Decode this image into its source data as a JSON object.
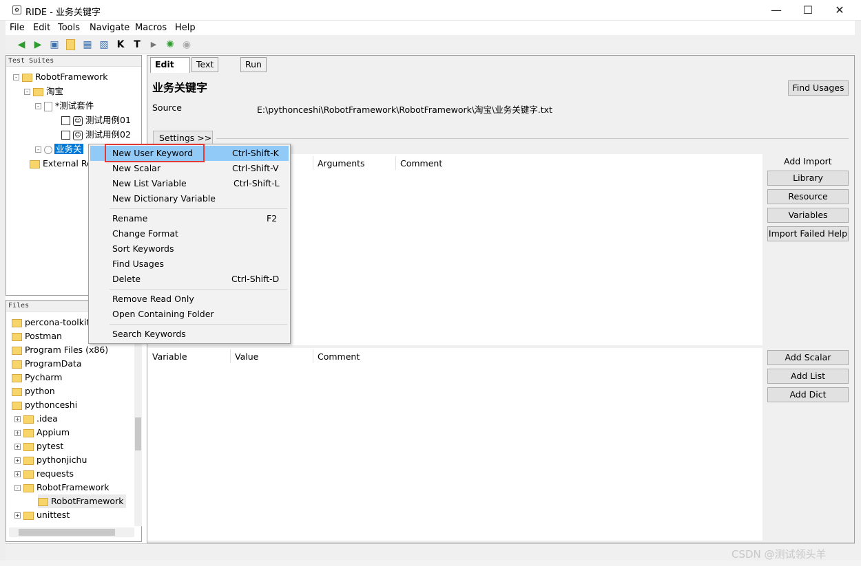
{
  "window": {
    "title": "RIDE - 业务关键字"
  },
  "menu": [
    "File",
    "Edit",
    "Tools",
    "Navigate",
    "Macros",
    "Help"
  ],
  "tree": {
    "header": "Test Suites",
    "items": [
      "RobotFramework",
      "淘宝",
      "*测试套件",
      "测试用例01",
      "测试用例02",
      "业务关",
      "External Re"
    ]
  },
  "files": {
    "header": "Files",
    "items": [
      "percona-toolkit",
      "Postman",
      "Program Files (x86)",
      "ProgramData",
      "Pycharm",
      "python",
      "pythonceshi",
      ".idea",
      "Appium",
      "pytest",
      "pythonjichu",
      "requests",
      "RobotFramework",
      "RobotFramework",
      "unittest"
    ]
  },
  "tabs": [
    "Edit",
    "Text Edit",
    "Run"
  ],
  "editor": {
    "title": "业务关键字",
    "source_label": "Source",
    "source_path": "E:\\pythonceshi\\RobotFramework\\RobotFramework\\淘宝\\业务关键字.txt",
    "find_usages": "Find Usages",
    "settings_toggle": "Settings >>",
    "import_columns": [
      "Arguments",
      "Comment"
    ],
    "add_import_label": "Add Import",
    "import_buttons": [
      "Library",
      "Resource",
      "Variables",
      "Import Failed Help"
    ],
    "variable_columns": [
      "Variable",
      "Value",
      "Comment"
    ],
    "variable_buttons": [
      "Add Scalar",
      "Add List",
      "Add Dict"
    ]
  },
  "context_menu": {
    "items": [
      {
        "label": "New User Keyword",
        "shortcut": "Ctrl-Shift-K"
      },
      {
        "label": "New Scalar",
        "shortcut": "Ctrl-Shift-V"
      },
      {
        "label": "New List Variable",
        "shortcut": "Ctrl-Shift-L"
      },
      {
        "label": "New Dictionary Variable",
        "shortcut": ""
      },
      {
        "label": "Rename",
        "shortcut": "F2"
      },
      {
        "label": "Change Format",
        "shortcut": ""
      },
      {
        "label": "Sort Keywords",
        "shortcut": ""
      },
      {
        "label": "Find Usages",
        "shortcut": ""
      },
      {
        "label": "Delete",
        "shortcut": "Ctrl-Shift-D"
      },
      {
        "label": "Remove Read Only",
        "shortcut": ""
      },
      {
        "label": "Open Containing Folder",
        "shortcut": ""
      },
      {
        "label": "Search Keywords",
        "shortcut": ""
      }
    ]
  },
  "watermark": "CSDN @测试领头羊",
  "colors": {
    "selection": "#0078d7",
    "menu_highlight": "#91c9f7",
    "annotation_box": "#e53935"
  }
}
